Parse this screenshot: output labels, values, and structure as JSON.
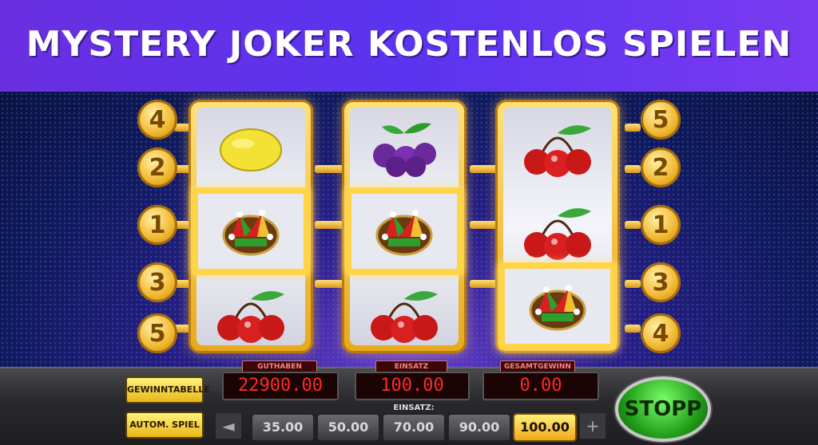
{
  "banner": {
    "title": "MYSTERY JOKER KOSTENLOS SPIELEN"
  },
  "paylines": {
    "left": [
      "4",
      "2",
      "1",
      "3",
      "5"
    ],
    "right": [
      "5",
      "2",
      "1",
      "3",
      "4"
    ]
  },
  "reels": [
    [
      "lemon",
      "joker",
      "cherry"
    ],
    [
      "plum",
      "joker",
      "cherry"
    ],
    [
      "cherry",
      "cherry",
      "joker"
    ]
  ],
  "display": {
    "guthaben_label": "GUTHABEN",
    "guthaben_value": "22900.00",
    "einsatz_label": "EINSATZ",
    "einsatz_value": "100.00",
    "gesamtgewinn_label": "GESAMTGEWINN",
    "gesamtgewinn_value": "0.00"
  },
  "controls": {
    "gewinntabelle": "GEWINNTABELLE",
    "autom_spiel": "AUTOM. SPIEL",
    "einsatz_selector_label": "EINSATZ:",
    "bets": [
      "35.00",
      "50.00",
      "70.00",
      "90.00",
      "100.00"
    ],
    "selected_bet": "100.00",
    "prev": "◄",
    "next": "+",
    "stopp": "STOPP"
  },
  "colors": {
    "accent": "#f0b830",
    "banner": "#5a34f0",
    "stopp": "#22a01a",
    "lcd_text": "#ff2a2a"
  }
}
